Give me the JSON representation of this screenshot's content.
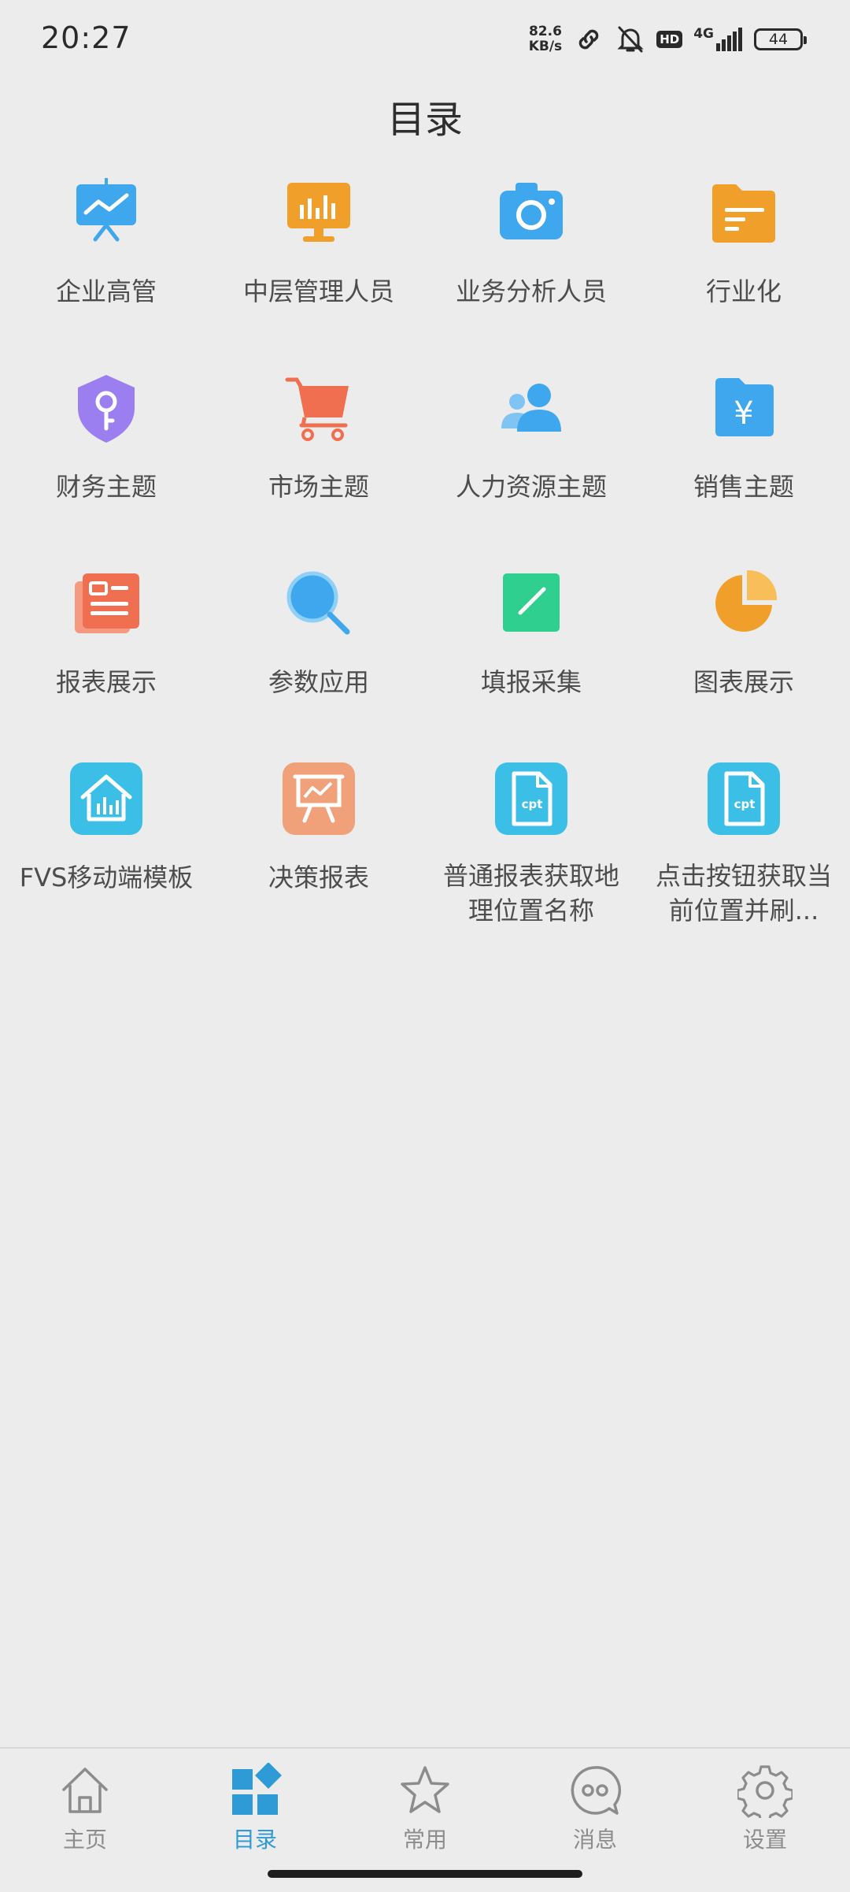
{
  "status_bar": {
    "time": "20:27",
    "net_speed_value": "82.6",
    "net_speed_unit": "KB/s",
    "hd_badge": "HD",
    "network": "4G",
    "battery": "44"
  },
  "page": {
    "title": "目录"
  },
  "catalog": {
    "items": [
      {
        "label": "企业高管",
        "icon": "presentation-board-icon",
        "color": "#3fa7ee"
      },
      {
        "label": "中层管理人员",
        "icon": "monitor-chart-icon",
        "color": "#f0a02a"
      },
      {
        "label": "业务分析人员",
        "icon": "camera-icon",
        "color": "#3fa7ee"
      },
      {
        "label": "行业化",
        "icon": "folder-icon",
        "color": "#f0a02a"
      },
      {
        "label": "财务主题",
        "icon": "shield-key-icon",
        "color": "#9b7ff0"
      },
      {
        "label": "市场主题",
        "icon": "shopping-cart-icon",
        "color": "#ef6f50"
      },
      {
        "label": "人力资源主题",
        "icon": "people-icon",
        "color": "#3fa7ee"
      },
      {
        "label": "销售主题",
        "icon": "yen-folder-icon",
        "color": "#3fa7ee"
      },
      {
        "label": "报表展示",
        "icon": "report-card-icon",
        "color": "#ef6f50"
      },
      {
        "label": "参数应用",
        "icon": "magnifier-icon",
        "color": "#3fa7ee"
      },
      {
        "label": "填报采集",
        "icon": "edit-pad-icon",
        "color": "#2fcf8f"
      },
      {
        "label": "图表展示",
        "icon": "pie-chart-icon",
        "color": "#f0a02a"
      },
      {
        "label": "FVS移动端模板",
        "icon": "house-chart-icon",
        "color": "#3cbfe6"
      },
      {
        "label": "决策报表",
        "icon": "easel-icon",
        "color": "#f0a17a"
      },
      {
        "label": "普通报表获取地理位置名称",
        "icon": "cpt-file-icon",
        "color": "#3cbfe6",
        "cpt": "cpt"
      },
      {
        "label": "点击按钮获取当前位置并刷...",
        "icon": "cpt-file-icon",
        "color": "#3cbfe6",
        "cpt": "cpt"
      }
    ]
  },
  "bottom_nav": {
    "items": [
      {
        "label": "主页",
        "icon": "home-icon"
      },
      {
        "label": "目录",
        "icon": "catalog-grid-icon",
        "active": true
      },
      {
        "label": "常用",
        "icon": "star-icon"
      },
      {
        "label": "消息",
        "icon": "message-icon"
      },
      {
        "label": "设置",
        "icon": "gear-icon"
      }
    ],
    "active_color": "#2f9bd6",
    "inactive_color": "#8c8c8c"
  }
}
